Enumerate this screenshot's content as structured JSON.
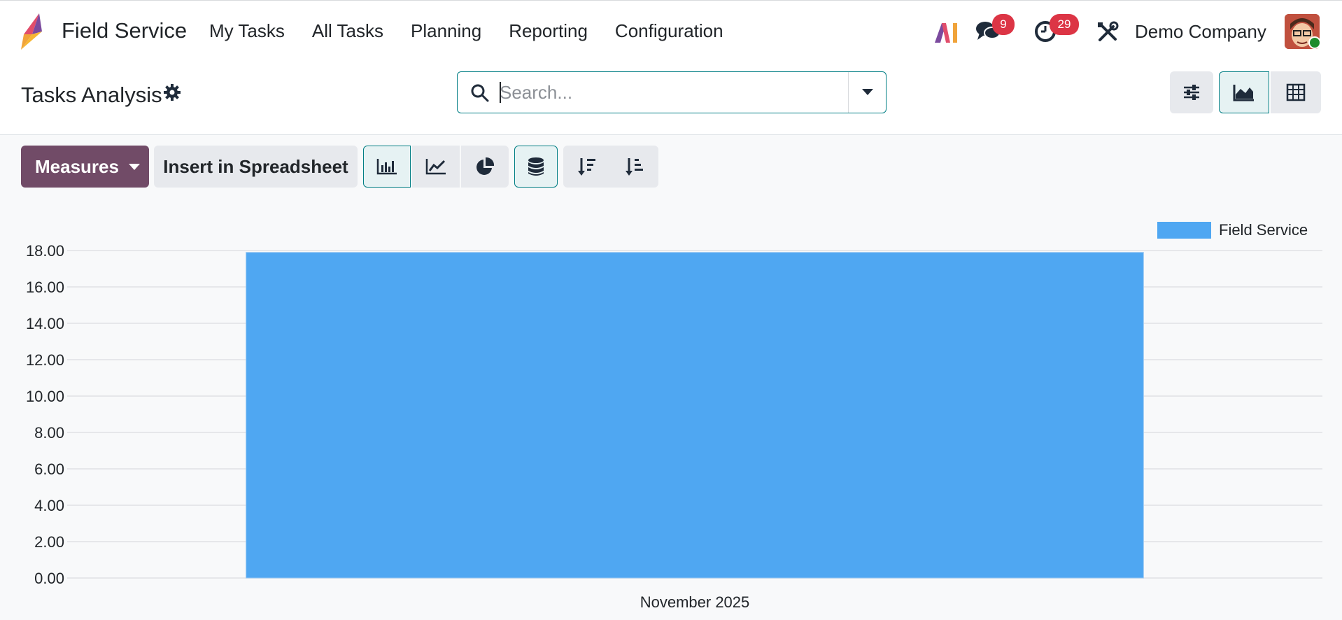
{
  "navbar": {
    "app_name": "Field Service",
    "menu": [
      "My Tasks",
      "All Tasks",
      "Planning",
      "Reporting",
      "Configuration"
    ],
    "messages_count": "9",
    "activities_count": "29",
    "company": "Demo Company"
  },
  "control_panel": {
    "title": "Tasks Analysis",
    "search": {
      "placeholder": "Search...",
      "value": ""
    }
  },
  "toolbar": {
    "measures_label": "Measures",
    "spreadsheet_label": "Insert in Spreadsheet"
  },
  "colors": {
    "brand": "#714b67",
    "accent": "#017e84",
    "bar": "#4fa7f2",
    "badge": "#dc3545"
  },
  "chart_data": {
    "type": "bar",
    "categories": [
      "November 2025"
    ],
    "series": [
      {
        "name": "Field Service",
        "values": [
          17.9
        ]
      }
    ],
    "ylim": [
      0,
      18
    ],
    "yticks": [
      "0.00",
      "2.00",
      "4.00",
      "6.00",
      "8.00",
      "10.00",
      "12.00",
      "14.00",
      "16.00",
      "18.00"
    ],
    "grid": true,
    "legend": "top-right"
  }
}
